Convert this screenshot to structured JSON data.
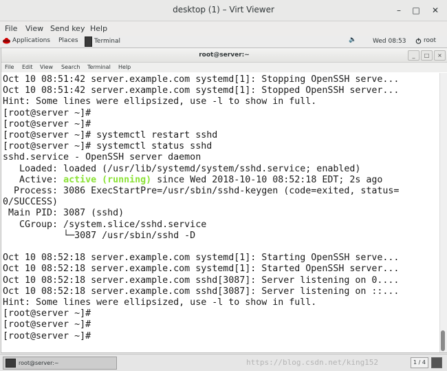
{
  "window": {
    "title": "desktop (1) – Virt Viewer",
    "minimize": "–",
    "maximize": "□",
    "close": "✕"
  },
  "menubar": {
    "file": "File",
    "view": "View",
    "send_key": "Send key",
    "help": "Help"
  },
  "gnome_bar": {
    "applications": "Applications",
    "places": "Places",
    "task_terminal": "Terminal",
    "volume": "🔈",
    "clock": "Wed 08:53",
    "user": "root"
  },
  "terminal": {
    "title": "root@server:~",
    "buttons": {
      "minimize": "_",
      "maximize": "□",
      "close": "×"
    },
    "menu": {
      "file": "File",
      "edit": "Edit",
      "view": "View",
      "search": "Search",
      "terminal": "Terminal",
      "help": "Help"
    },
    "lines": {
      "l01": "Oct 10 08:51:42 server.example.com systemd[1]: Stopping OpenSSH serve...",
      "l02": "Oct 10 08:51:42 server.example.com systemd[1]: Stopped OpenSSH server...",
      "l03": "Hint: Some lines were ellipsized, use -l to show in full.",
      "l04": "[root@server ~]#",
      "l05": "[root@server ~]#",
      "l06": "[root@server ~]# systemctl restart sshd",
      "l07": "[root@server ~]# systemctl status sshd",
      "l08": "sshd.service - OpenSSH server daemon",
      "l09": "   Loaded: loaded (/usr/lib/systemd/system/sshd.service; enabled)",
      "l10_pre": "   Active: ",
      "l10_active": "active (running)",
      "l10_post": " since Wed 2018-10-10 08:52:18 EDT; 2s ago",
      "l11": "  Process: 3086 ExecStartPre=/usr/sbin/sshd-keygen (code=exited, status=",
      "l12": "0/SUCCESS)",
      "l13": " Main PID: 3087 (sshd)",
      "l14": "   CGroup: /system.slice/sshd.service",
      "l15": "           └─3087 /usr/sbin/sshd -D",
      "l16": "",
      "l17": "Oct 10 08:52:18 server.example.com systemd[1]: Starting OpenSSH serve...",
      "l18": "Oct 10 08:52:18 server.example.com systemd[1]: Started OpenSSH server...",
      "l19": "Oct 10 08:52:18 server.example.com sshd[3087]: Server listening on 0....",
      "l20": "Oct 10 08:52:18 server.example.com sshd[3087]: Server listening on ::...",
      "l21": "Hint: Some lines were ellipsized, use -l to show in full.",
      "l22": "[root@server ~]#",
      "l23": "[root@server ~]#",
      "l24": "[root@server ~]#"
    },
    "active_color": "#8ae234"
  },
  "bottom_bar": {
    "task_label": "root@server:~",
    "watermark": "https://blog.csdn.net/king152",
    "pager": "1 / 4"
  }
}
